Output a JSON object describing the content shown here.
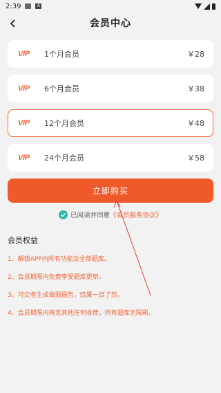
{
  "status_bar": {
    "time": "2:39"
  },
  "header": {
    "title": "会员中心"
  },
  "plans": [
    {
      "badge": "VIP",
      "label": "1个月会员",
      "price": "￥28"
    },
    {
      "badge": "VIP",
      "label": "6个月会员",
      "price": "￥38"
    },
    {
      "badge": "VIP",
      "label": "12个月会员",
      "price": "￥48"
    },
    {
      "badge": "VIP",
      "label": "24个月会员",
      "price": "￥58"
    }
  ],
  "buy_button": {
    "label": "立即购买"
  },
  "agreement": {
    "text": "已阅读并同意",
    "link": "《会员服务协议》"
  },
  "benefits": {
    "title": "会员权益",
    "items": [
      "1、解锁APP内所有功能及全部题库。",
      "2、会员期限内免费享受题库更新。",
      "3、可交卷生成做题报告，结果一目了然。",
      "4、会员期限内再无其他任何收费，所有题库无限刷。"
    ]
  },
  "colors": {
    "accent": "#f05a2b",
    "check": "#2eb8a6",
    "background": "#f2f2f2"
  }
}
